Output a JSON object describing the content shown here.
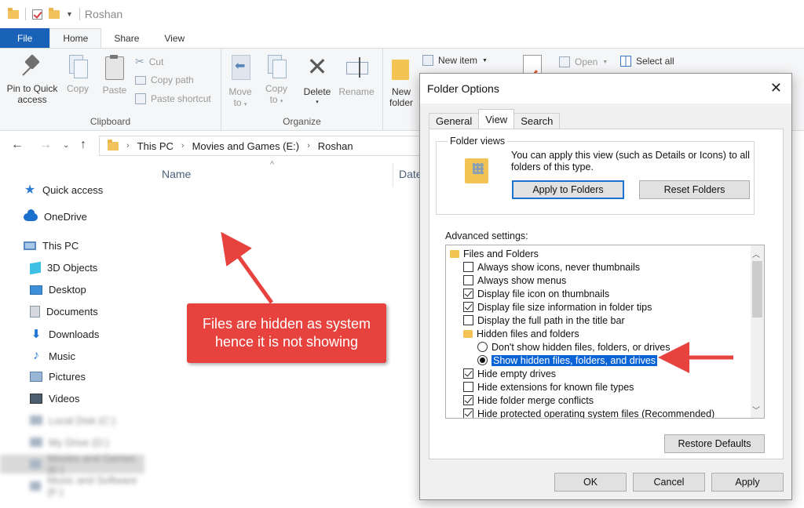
{
  "window": {
    "title": "Roshan"
  },
  "ribbon_tabs": [
    "File",
    "Home",
    "Share",
    "View"
  ],
  "ribbon": {
    "clipboard": {
      "label": "Clipboard",
      "pin_line1": "Pin to Quick",
      "pin_line2": "access",
      "copy": "Copy",
      "paste": "Paste",
      "cut": "Cut",
      "copy_path": "Copy path",
      "paste_shortcut": "Paste shortcut"
    },
    "organize": {
      "label": "Organize",
      "move_to_line1": "Move",
      "move_to_line2": "to",
      "copy_to_line1": "Copy",
      "copy_to_line2": "to",
      "delete": "Delete",
      "rename": "Rename"
    },
    "new": {
      "new_folder_line1": "New",
      "new_folder_line2": "folder",
      "new_item": "New item"
    },
    "open": {
      "open": "Open"
    },
    "select": {
      "select_all": "Select all"
    }
  },
  "address": {
    "crumbs": [
      "This PC",
      "Movies and Games (E:)",
      "Roshan"
    ]
  },
  "nav": {
    "quick_access": "Quick access",
    "onedrive": "OneDrive",
    "this_pc": "This PC",
    "objects3d": "3D Objects",
    "desktop": "Desktop",
    "documents": "Documents",
    "downloads": "Downloads",
    "music": "Music",
    "pictures": "Pictures",
    "videos": "Videos",
    "blurred": [
      "Local Disk (C:)",
      "My Drive (D:)",
      "Movies and Games (E:)",
      "Music and Software (F:)"
    ]
  },
  "content": {
    "col_name": "Name",
    "col_date": "Date"
  },
  "annotation": {
    "line1": "Files are hidden as system",
    "line2": "hence it is not showing"
  },
  "dialog": {
    "title": "Folder Options",
    "tabs": [
      "General",
      "View",
      "Search"
    ],
    "folder_views_label": "Folder views",
    "folder_views_text": "You can apply this view (such as Details or Icons) to all folders of this type.",
    "apply_to_folders": "Apply to Folders",
    "reset_folders": "Reset Folders",
    "advanced_label": "Advanced settings:",
    "tree": {
      "files_and_folders": "Files and Folders",
      "items": [
        {
          "label": "Always show icons, never thumbnails",
          "checked": false
        },
        {
          "label": "Always show menus",
          "checked": false
        },
        {
          "label": "Display file icon on thumbnails",
          "checked": true
        },
        {
          "label": "Display file size information in folder tips",
          "checked": true
        },
        {
          "label": "Display the full path in the title bar",
          "checked": false
        }
      ],
      "hidden_group": "Hidden files and folders",
      "radio_dont_show": "Don't show hidden files, folders, or drives",
      "radio_show": "Show hidden files, folders, and drives",
      "items2": [
        {
          "label": "Hide empty drives",
          "checked": true
        },
        {
          "label": "Hide extensions for known file types",
          "checked": false
        },
        {
          "label": "Hide folder merge conflicts",
          "checked": true
        },
        {
          "label": "Hide protected operating system files (Recommended)",
          "checked": true
        }
      ]
    },
    "restore_defaults": "Restore Defaults",
    "ok": "OK",
    "cancel": "Cancel",
    "apply": "Apply"
  },
  "colors": {
    "accent": "#1a62b8",
    "callout": "#e8423f",
    "selection": "#0a64d6"
  }
}
